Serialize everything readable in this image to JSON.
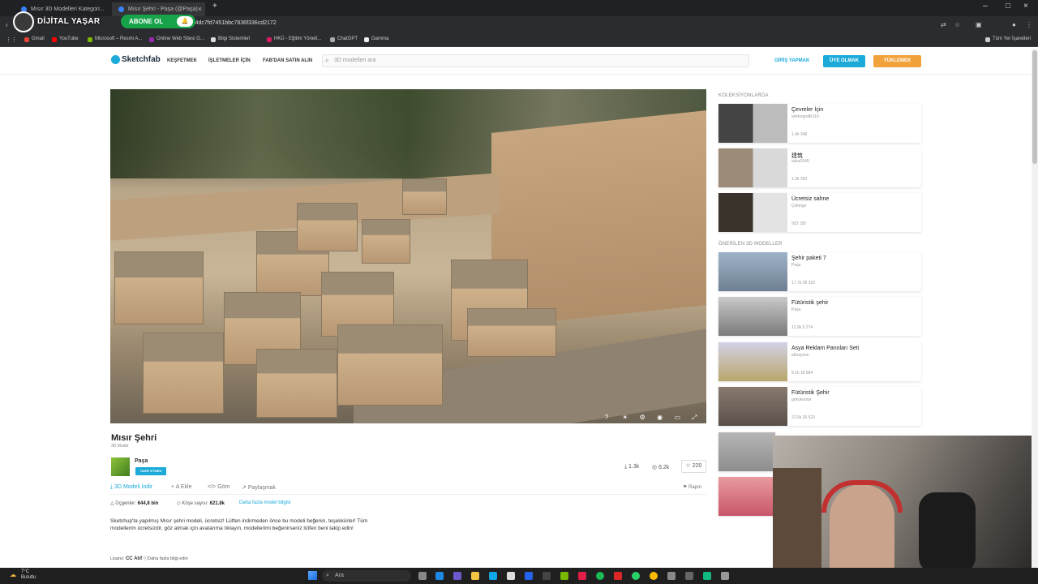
{
  "browser": {
    "tabs": [
      {
        "label": "Mısır 3D Modelleri Kategori..."
      },
      {
        "label": "Mısır Şehri - Paşa (@Paşa) [..."
      }
    ],
    "new_tab": "+",
    "url": "1bf14dc7fd7451bbc7836f336cd2172",
    "bookmarks": [
      "Gmail",
      "YouTube",
      "Microsoft – Resmi A...",
      "Online Web Sitesi G...",
      "Bilgi Sistemleri",
      "HKÜ - Eğitim Yöneti...",
      "ChatGPT",
      "Gamma"
    ],
    "all_bookmarks": "Tüm Yer İşaretleri"
  },
  "overlay": {
    "channel_name": "DİJİTAL YAŞAR",
    "subscribe_label": "ABONE OL"
  },
  "header": {
    "logo": "Sketchfab",
    "nav": [
      "KEŞFETMEK",
      "İŞLETMELER İÇİN",
      "FAB'DAN SATIN ALIN"
    ],
    "search_placeholder": "3D modelleri ara",
    "login": "GİRİŞ YAPMAK",
    "signup": "ÜYE OLMAK",
    "upload": "YÜKLEMEK"
  },
  "model": {
    "title": "Mısır Şehri",
    "type": "3D Model",
    "author": "Paşa",
    "follow": "TAKİP ETMEK",
    "downloads": "1.3k",
    "views": "6.2k",
    "likes": "220",
    "actions": [
      "3D Modeli İndir",
      "A Ekle",
      "Göm",
      "Paylaşmak"
    ],
    "report": "Rapor",
    "triangles_label": "Üçgenler:",
    "triangles": "644,8 bin",
    "vertices_label": "Köşe sayısı:",
    "vertices": "621.8k",
    "more_info": "Daha fazla model bilgisi",
    "description": "Sketchup'ta yapılmış Mısır şehri modeli, ücretsiz! Lütfen indirmeden önce bu modeli beğenin, teşekkürler! Tüm modellerim ücretsizdir, göz atmak için avatarıma tıklayın, modellerimi beğenirseniz lütfen beni takip edin!",
    "license_label": "Lisans:",
    "license": "CC Atıf",
    "license_more": "Daha fazla bilgi edin"
  },
  "sidebar": {
    "collections_head": "KOLEKSİYONLARDA",
    "collections": [
      {
        "title": "Çevreler İçin",
        "author": "vektorgrafik110",
        "stats": "1.4k   348"
      },
      {
        "title": "建筑",
        "author": "suka2049",
        "stats": "1.2k   260"
      },
      {
        "title": "Ücretsiz sahne",
        "author": "Çekinge",
        "stats": "923   195"
      }
    ],
    "recommended_head": "ÖNERİLEN 3D MODELLER",
    "recommended": [
      {
        "title": "Şehir paketi 7",
        "author": "Paşa",
        "stats": "17.7k   28   310"
      },
      {
        "title": "Fütüristik şehir",
        "author": "Paşa",
        "stats": "12.9k   5   274"
      },
      {
        "title": "Asya Reklam Panoları Seti",
        "author": "abhaysse",
        "stats": "9.1k   18   584"
      },
      {
        "title": "Fütüristik Şehir",
        "author": "gokukumar",
        "stats": "22.5k   26   523"
      }
    ]
  },
  "taskbar": {
    "temp": "7°C",
    "weather": "Bulutlu",
    "search": "Ara"
  },
  "colors": {
    "accent": "#1caad9",
    "upload": "#f2a23a",
    "subscribe": "#17a34a"
  }
}
